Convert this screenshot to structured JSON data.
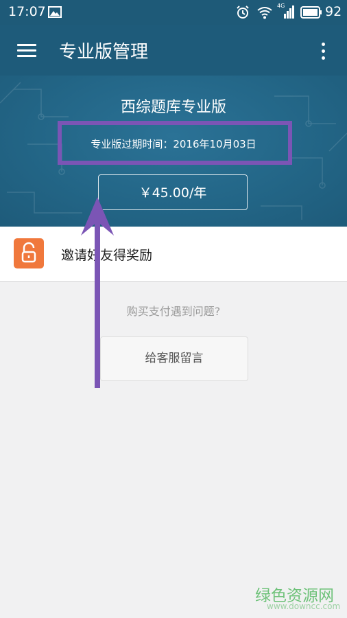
{
  "status_bar": {
    "time": "17:07",
    "battery_level": "92",
    "network_label": "4G",
    "icons": [
      "image-icon",
      "alarm-icon",
      "wifi-icon",
      "signal-icon",
      "battery-icon"
    ]
  },
  "app_bar": {
    "title": "专业版管理",
    "icons": [
      "menu-icon",
      "more-vert-icon"
    ],
    "background": "#1e5b7a"
  },
  "header": {
    "product_name": "西综题库专业版",
    "expiry_text": "专业版过期时间：2016年10月03日",
    "price_label": "￥45.00/年"
  },
  "invite": {
    "label": "邀请好友得奖励",
    "icon": "unlock-icon",
    "icon_color": "#f0783c"
  },
  "help": {
    "question": "购买支付遇到问题?",
    "message_button": "给客服留言"
  },
  "annotation": {
    "color": "#7b55b5"
  },
  "watermark": {
    "main": "绿色资源网",
    "url": "www.downcc.com"
  }
}
